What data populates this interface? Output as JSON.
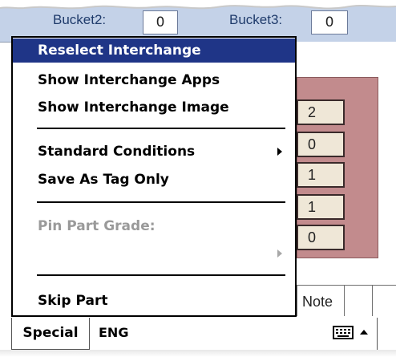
{
  "background": {
    "bucket2_label": "Bucket2:",
    "bucket2_value": "0",
    "bucket3_label": "Bucket3:",
    "bucket3_value": "0",
    "values": [
      "2",
      "0",
      "1",
      "1",
      "0"
    ],
    "tab_note": "Note"
  },
  "menu": {
    "items": [
      {
        "label": "Reselect Interchange",
        "state": "selected"
      },
      {
        "label": "Show Interchange Apps",
        "state": "normal"
      },
      {
        "label": "Show Interchange Image",
        "state": "normal"
      },
      {
        "label": "Standard Conditions",
        "state": "normal",
        "submenu": true
      },
      {
        "label": "Save As Tag Only",
        "state": "normal"
      },
      {
        "label": "Pin Part Grade:",
        "state": "disabled"
      },
      {
        "label": "",
        "state": "disabled",
        "submenu": true
      },
      {
        "label": "Skip Part",
        "state": "normal"
      }
    ]
  },
  "toolbar": {
    "special_label": "Special",
    "lang_label": "ENG",
    "keyboard_icon": "keyboard-icon",
    "up_icon": "caret-up-icon"
  },
  "colors": {
    "selected_bg": "#1f3587",
    "panel_pink": "#c28b8d",
    "top_strip": "#c4d2e8"
  }
}
